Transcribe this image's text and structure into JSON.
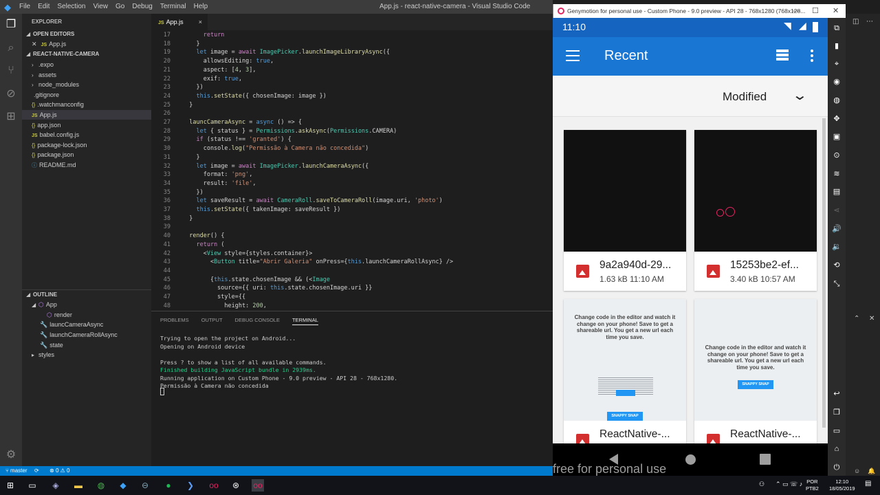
{
  "vscode": {
    "menu": [
      "File",
      "Edit",
      "Selection",
      "View",
      "Go",
      "Debug",
      "Terminal",
      "Help"
    ],
    "window_title": "App.js - react-native-camera - Visual Studio Code",
    "explorer": {
      "header": "EXPLORER",
      "open_editors_label": "OPEN EDITORS",
      "open_editor_file": "App.js",
      "project_label": "REACT-NATIVE-CAMERA",
      "items": [
        ".expo",
        "assets",
        "node_modules",
        ".gitignore",
        ".watchmanconfig",
        "App.js",
        "app.json",
        "babel.config.js",
        "package-lock.json",
        "package.json",
        "README.md"
      ]
    },
    "outline": {
      "header": "OUTLINE",
      "items": [
        "App",
        "render",
        "launcCameraAsync",
        "launchCameraRollAsync",
        "state",
        "styles"
      ]
    },
    "tab": {
      "label": "App.js",
      "close": "×"
    },
    "code_lines": [
      {
        "n": "17",
        "t": "      return"
      },
      {
        "n": "18",
        "t": "    }"
      },
      {
        "n": "19",
        "t": "    let image = await ImagePicker.launchImageLibraryAsync({"
      },
      {
        "n": "20",
        "t": "      allowsEditing: true,"
      },
      {
        "n": "21",
        "t": "      aspect: [4, 3],"
      },
      {
        "n": "22",
        "t": "      exif: true,"
      },
      {
        "n": "23",
        "t": "    })"
      },
      {
        "n": "24",
        "t": "    this.setState({ chosenImage: image })"
      },
      {
        "n": "25",
        "t": "  }"
      },
      {
        "n": "26",
        "t": ""
      },
      {
        "n": "27",
        "t": "  launcCameraAsync = async () => {"
      },
      {
        "n": "28",
        "t": "    let { status } = Permissions.askAsync(Permissions.CAMERA)"
      },
      {
        "n": "29",
        "t": "    if (status !== 'granted') {"
      },
      {
        "n": "30",
        "t": "      console.log(\"Permissão à Camera não concedida\")"
      },
      {
        "n": "31",
        "t": "    }"
      },
      {
        "n": "32",
        "t": "    let image = await ImagePicker.launchCameraAsync({"
      },
      {
        "n": "33",
        "t": "      format: 'png',"
      },
      {
        "n": "34",
        "t": "      result: 'file',"
      },
      {
        "n": "35",
        "t": "    })"
      },
      {
        "n": "36",
        "t": "    let saveResult = await CameraRoll.saveToCameraRoll(image.uri, 'photo')"
      },
      {
        "n": "37",
        "t": "    this.setState({ takenImage: saveResult })"
      },
      {
        "n": "38",
        "t": "  }"
      },
      {
        "n": "39",
        "t": ""
      },
      {
        "n": "40",
        "t": "  render() {"
      },
      {
        "n": "41",
        "t": "    return ("
      },
      {
        "n": "42",
        "t": "      <View style={styles.container}>"
      },
      {
        "n": "43",
        "t": "        <Button title=\"Abrir Galeria\" onPress={this.launchCameraRollAsync} />"
      },
      {
        "n": "44",
        "t": ""
      },
      {
        "n": "45",
        "t": "        {this.state.chosenImage && (<Image"
      },
      {
        "n": "46",
        "t": "          source={{ uri: this.state.chosenImage.uri }}"
      },
      {
        "n": "47",
        "t": "          style={{"
      },
      {
        "n": "48",
        "t": "            height: 200,"
      }
    ],
    "panel_tabs": [
      "PROBLEMS",
      "OUTPUT",
      "DEBUG CONSOLE",
      "TERMINAL"
    ],
    "terminal_lines": [
      {
        "t": "Trying to open the project on Android...",
        "c": ""
      },
      {
        "t": "Opening on Android device",
        "c": ""
      },
      {
        "t": "",
        "c": ""
      },
      {
        "t": "Press ? to show a list of all available commands.",
        "c": ""
      },
      {
        "t": "Finished building JavaScript bundle in 2939ms.",
        "c": "green"
      },
      {
        "t": "Running application on Custom Phone - 9.0 preview - API 28 - 768x1280.",
        "c": ""
      },
      {
        "t": "Permissão à Camera não concedida",
        "c": ""
      }
    ],
    "status": {
      "branch": "master",
      "errors": "0",
      "warnings": "0"
    }
  },
  "genymotion": {
    "window_title": "Genymotion for personal use - Custom Phone - 9.0 preview - API 28 - 768x1280 (768x128...",
    "time": "11:10",
    "app_title": "Recent",
    "sort_label": "Modified",
    "watermark": "free for personal use",
    "files": [
      {
        "name": "9a2a940d-29...",
        "meta": "1.63 kB 11:10 AM"
      },
      {
        "name": "15253be2-ef...",
        "meta": "3.40 kB 10:57 AM"
      },
      {
        "name": "ReactNative-...",
        "meta": ""
      },
      {
        "name": "ReactNative-...",
        "meta": ""
      }
    ],
    "preview_text": "Change code in the editor and watch it change on your phone! Save to get a shareable url. You get a new url each time you save.",
    "preview_button": "SNAPPY SNAP"
  },
  "taskbar": {
    "lang": "POR",
    "layout": "PTB2",
    "time": "12:10",
    "date": "18/05/2019"
  },
  "colors": {
    "accent": "#1976d2",
    "status_bar": "#007acc",
    "file_icon": "#d32f2f"
  }
}
